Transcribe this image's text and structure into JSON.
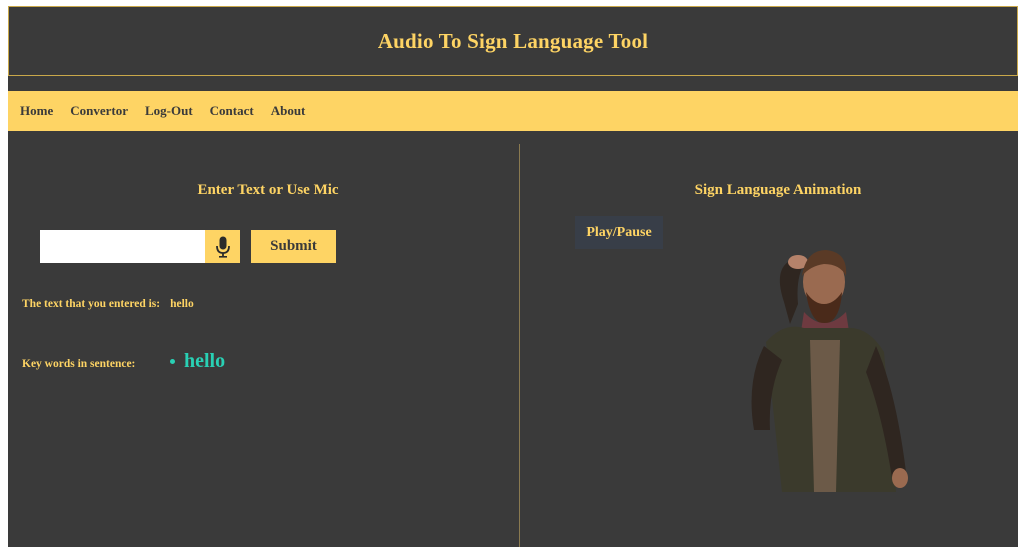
{
  "header": {
    "title": "Audio To Sign Language Tool"
  },
  "nav": {
    "items": [
      {
        "label": "Home"
      },
      {
        "label": "Convertor"
      },
      {
        "label": "Log-Out"
      },
      {
        "label": "Contact"
      },
      {
        "label": "About"
      }
    ]
  },
  "left_panel": {
    "heading": "Enter Text or Use Mic",
    "input": {
      "value": "",
      "placeholder": ""
    },
    "mic_icon": "microphone-icon",
    "submit_label": "Submit",
    "entered_label": "The text that you entered is:",
    "entered_value": "hello",
    "keywords_label": "Key words in sentence:",
    "keywords": [
      "hello"
    ]
  },
  "right_panel": {
    "heading": "Sign Language Animation",
    "play_label": "Play/Pause"
  },
  "colors": {
    "background": "#3a3a3a",
    "accent": "#fed464",
    "keyword": "#29d0b4",
    "play_button_bg": "#383e48"
  }
}
